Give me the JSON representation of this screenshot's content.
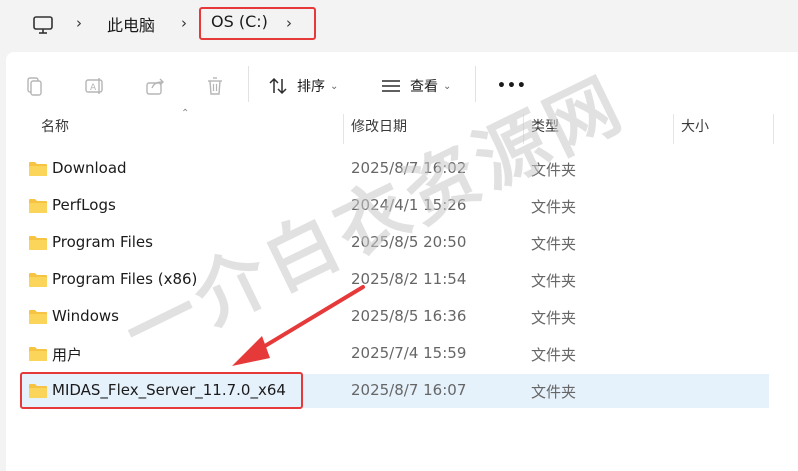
{
  "breadcrumb": {
    "items": [
      "此电脑",
      "OS (C:)"
    ]
  },
  "toolbar": {
    "sort_label": "排序",
    "view_label": "查看",
    "more_label": "•••"
  },
  "columns": {
    "name": "名称",
    "date": "修改日期",
    "type": "类型",
    "size": "大小"
  },
  "files": [
    {
      "name": "Download",
      "date": "2025/8/7 16:02",
      "type": "文件夹"
    },
    {
      "name": "PerfLogs",
      "date": "2024/4/1 15:26",
      "type": "文件夹"
    },
    {
      "name": "Program Files",
      "date": "2025/8/5 20:50",
      "type": "文件夹"
    },
    {
      "name": "Program Files (x86)",
      "date": "2025/8/2 11:54",
      "type": "文件夹"
    },
    {
      "name": "Windows",
      "date": "2025/8/5 16:36",
      "type": "文件夹"
    },
    {
      "name": "用户",
      "date": "2025/7/4 15:59",
      "type": "文件夹"
    },
    {
      "name": "MIDAS_Flex_Server_11.7.0_x64",
      "date": "2025/8/7 16:07",
      "type": "文件夹",
      "selected": true
    }
  ],
  "watermark": "一介白衣资源网",
  "colors": {
    "accent_red": "#e63a3a",
    "folder_yellow": "#f6c343",
    "selection_bg": "#e5f1fb"
  }
}
